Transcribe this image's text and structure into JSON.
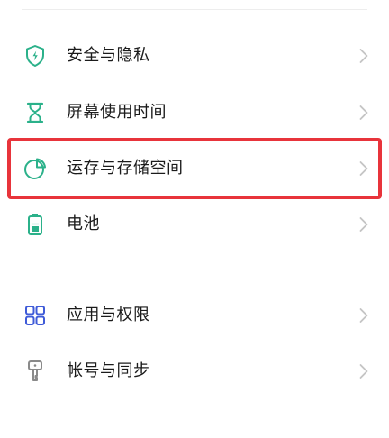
{
  "settings_list": {
    "group1": [
      {
        "label": "安全与隐私",
        "icon": "shield-icon",
        "color": "#2bb18a"
      },
      {
        "label": "屏幕使用时间",
        "icon": "hourglass-icon",
        "color": "#2bb18a"
      },
      {
        "label": "运存与存储空间",
        "icon": "pie-chart-icon",
        "color": "#2bb18a"
      },
      {
        "label": "电池",
        "icon": "battery-icon",
        "color": "#2bb18a"
      }
    ],
    "group2": [
      {
        "label": "应用与权限",
        "icon": "apps-grid-icon",
        "color": "#3f5bd8"
      },
      {
        "label": "帐号与同步",
        "icon": "key-icon",
        "color": "#8a8a8a"
      }
    ]
  },
  "highlight_color": "#e8343b"
}
